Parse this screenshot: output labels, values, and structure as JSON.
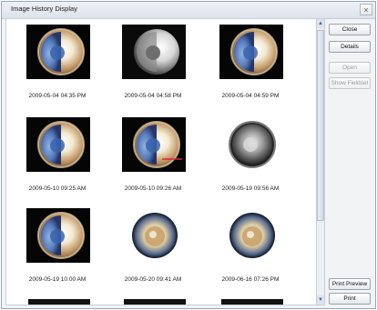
{
  "window": {
    "title": "Image History Display",
    "close_glyph": "×"
  },
  "buttons": {
    "close": "Close",
    "details": "Details",
    "open": "Open",
    "show_fieldset": "Show Fieldset",
    "print_preview": "Print Preview",
    "print": "Print"
  },
  "thumbnails": [
    {
      "timestamp": "2009-05-04 04:35 PM",
      "style": "blue-bright"
    },
    {
      "timestamp": "2009-05-04 04:58 PM",
      "style": "gray-bright"
    },
    {
      "timestamp": "2009-05-04 04:59 PM",
      "style": "blue-bright"
    },
    {
      "timestamp": "2009-05-10 09:25 AM",
      "style": "blue-bright"
    },
    {
      "timestamp": "2009-05-10 09:26 AM",
      "style": "blue-bright-redline"
    },
    {
      "timestamp": "2009-05-19 09:56 AM",
      "style": "gray-dark"
    },
    {
      "timestamp": "2009-05-19 10:00 AM",
      "style": "blue-bright"
    },
    {
      "timestamp": "2009-05-20 09:41 AM",
      "style": "warm-white"
    },
    {
      "timestamp": "2009-06-16 07:26 PM",
      "style": "warm-white"
    }
  ],
  "colors": {
    "window_border": "#9aa6b6",
    "scroll_arrow": "#3b6bb5",
    "disabled_text": "#9a9a9a"
  }
}
